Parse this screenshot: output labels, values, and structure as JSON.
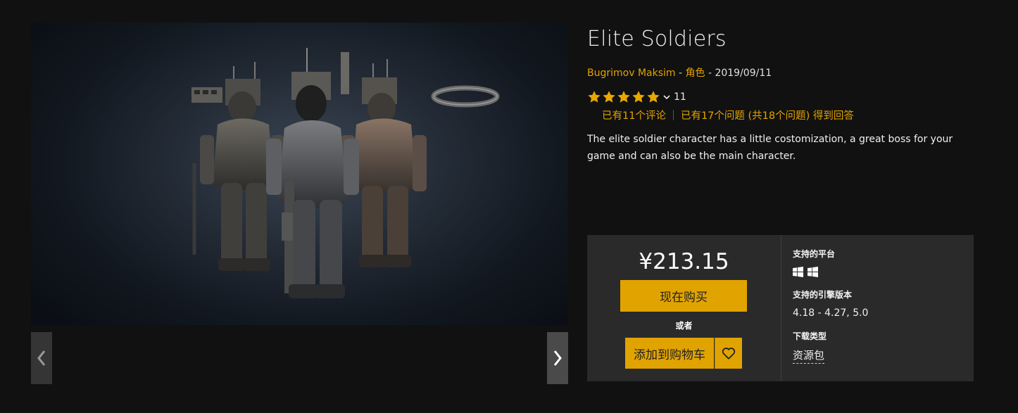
{
  "product": {
    "title": "Elite Soldiers",
    "author": "Bugrimov Maksim",
    "separator1": " - ",
    "category": "角色",
    "separator2": " - ",
    "date": "2019/09/11",
    "rating": {
      "stars": 5,
      "count": "11"
    },
    "reviews_link": "已有11个评论",
    "questions_link": "已有17个问题 (共18个问题) 得到回答",
    "description": "The elite soldier character has a little costomization, a great boss for your game and can also be the main character."
  },
  "purchase": {
    "price": "¥213.15",
    "buy_label": "现在购买",
    "or_label": "或者",
    "cart_label": "添加到购物车"
  },
  "specs": {
    "platforms_label": "支持的平台",
    "platform_icons": [
      "windows-icon",
      "windows-icon"
    ],
    "engine_label": "支持的引擎版本",
    "engine_versions": "4.18 - 4.27, 5.0",
    "download_label": "下载类型",
    "download_type": "资源包"
  },
  "colors": {
    "accent": "#e1a300",
    "link": "#e2a300",
    "background": "#111111",
    "panel": "#2a2a2a"
  },
  "gallery": {
    "prev_icon": "chevron-left-icon",
    "next_icon": "chevron-right-icon"
  }
}
